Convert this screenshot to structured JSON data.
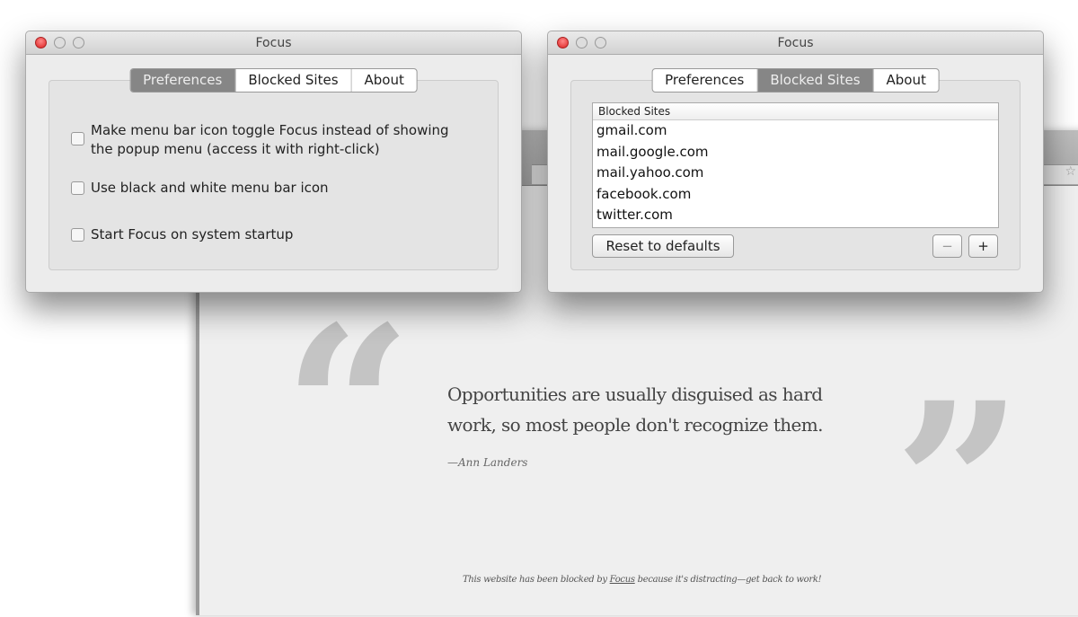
{
  "preferences_window": {
    "title": "Focus",
    "tabs": [
      "Preferences",
      "Blocked Sites",
      "About"
    ],
    "active_tab": "Preferences",
    "options": [
      {
        "label_line1": "Make menu bar icon toggle Focus instead of showing",
        "label_line2": "the popup menu (access it with right-click)",
        "checked": false
      },
      {
        "label": "Use black and white menu bar icon",
        "checked": false
      },
      {
        "label": "Start Focus on system startup",
        "checked": false
      }
    ]
  },
  "blocked_window": {
    "title": "Focus",
    "tabs": [
      "Preferences",
      "Blocked Sites",
      "About"
    ],
    "active_tab": "Blocked Sites",
    "list_header": "Blocked Sites",
    "sites": [
      "gmail.com",
      "mail.google.com",
      "mail.yahoo.com",
      "facebook.com",
      "twitter.com"
    ],
    "reset_label": "Reset to defaults",
    "remove_label": "−",
    "add_label": "+"
  },
  "blocked_page": {
    "open_quote": "“",
    "close_quote": "”",
    "quote": "Opportunities are usually disguised as hard work, so most people don't recognize them.",
    "author": "—Ann Landers",
    "footer_pre": "This website has been blocked by ",
    "footer_link": "Focus",
    "footer_post": " because it's distracting—get back to work!"
  }
}
